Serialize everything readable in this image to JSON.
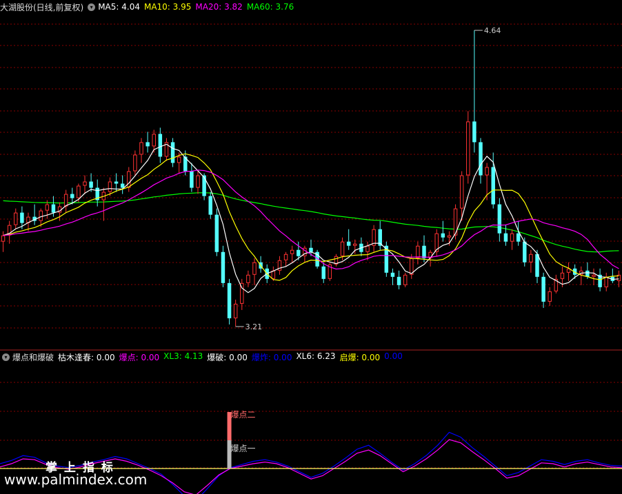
{
  "main_header": {
    "title": "大湖股份(日线,前复权)",
    "items": [
      {
        "label": "MA5: 4.04",
        "color": "#ffffff"
      },
      {
        "label": "MA10: 3.95",
        "color": "#ffff00"
      },
      {
        "label": "MA20: 3.82",
        "color": "#ff00ff"
      },
      {
        "label": "MA60: 3.76",
        "color": "#00ff00"
      }
    ]
  },
  "sub_header": {
    "title": "爆点和爆破",
    "items": [
      {
        "label": "枯木逢春: 0.00",
        "color": "#ffffff"
      },
      {
        "label": "爆点: 0.00",
        "color": "#ff00ff"
      },
      {
        "label": "XL3: 4.13",
        "color": "#00ff00"
      },
      {
        "label": "爆破: 0.00",
        "color": "#ffffff"
      },
      {
        "label": "爆炸: 0.00",
        "color": "#0000ff"
      },
      {
        "label": "XL6: 6.23",
        "color": "#ffffff"
      },
      {
        "label": "启爆: 0.00",
        "color": "#ffff00"
      },
      {
        "label": "0.00",
        "color": "#0000ff"
      }
    ]
  },
  "annotations": {
    "high": "4.64",
    "low": "3.21"
  },
  "signal_labels": {
    "upper": "爆点二",
    "lower": "爆点一"
  },
  "watermark": {
    "title": "掌 上 指 标",
    "url": "www.palmindex.com"
  },
  "colors": {
    "up": "#ff3232",
    "down": "#54ffff",
    "ma5": "#ffffff",
    "ma10": "#ffff00",
    "ma20": "#ff00ff",
    "ma60": "#00ff00",
    "grid": "#8b0000"
  },
  "chart_data": {
    "type": "candlestick",
    "y_range": [
      3.15,
      4.72
    ],
    "ma_windows": [
      5,
      10,
      20,
      60
    ],
    "ma60_start": 3.82,
    "candles": [
      [
        3.62,
        3.67,
        3.57,
        3.65
      ],
      [
        3.65,
        3.72,
        3.61,
        3.7
      ],
      [
        3.7,
        3.78,
        3.68,
        3.76
      ],
      [
        3.76,
        3.79,
        3.68,
        3.71
      ],
      [
        3.71,
        3.76,
        3.67,
        3.74
      ],
      [
        3.74,
        3.8,
        3.7,
        3.72
      ],
      [
        3.72,
        3.78,
        3.69,
        3.77
      ],
      [
        3.77,
        3.82,
        3.73,
        3.8
      ],
      [
        3.8,
        3.84,
        3.74,
        3.76
      ],
      [
        3.76,
        3.81,
        3.72,
        3.79
      ],
      [
        3.79,
        3.87,
        3.76,
        3.85
      ],
      [
        3.85,
        3.88,
        3.8,
        3.83
      ],
      [
        3.83,
        3.9,
        3.81,
        3.89
      ],
      [
        3.89,
        3.94,
        3.85,
        3.91
      ],
      [
        3.91,
        3.95,
        3.86,
        3.88
      ],
      [
        3.88,
        3.92,
        3.79,
        3.82
      ],
      [
        3.82,
        3.88,
        3.72,
        3.86
      ],
      [
        3.86,
        3.93,
        3.84,
        3.91
      ],
      [
        3.91,
        3.95,
        3.86,
        3.9
      ],
      [
        3.9,
        3.94,
        3.85,
        3.88
      ],
      [
        3.88,
        3.98,
        3.86,
        3.96
      ],
      [
        3.96,
        4.06,
        3.94,
        4.04
      ],
      [
        4.04,
        4.12,
        4.0,
        4.1
      ],
      [
        4.1,
        4.15,
        4.05,
        4.08
      ],
      [
        4.08,
        4.16,
        4.05,
        4.14
      ],
      [
        4.14,
        4.17,
        4.0,
        4.03
      ],
      [
        4.03,
        4.12,
        4.01,
        4.1
      ],
      [
        4.1,
        4.12,
        3.98,
        4.0
      ],
      [
        4.0,
        4.05,
        3.95,
        4.03
      ],
      [
        4.03,
        4.06,
        3.94,
        3.96
      ],
      [
        3.96,
        4.0,
        3.86,
        3.88
      ],
      [
        3.88,
        3.96,
        3.85,
        3.94
      ],
      [
        3.94,
        3.95,
        3.82,
        3.84
      ],
      [
        3.84,
        3.86,
        3.73,
        3.75
      ],
      [
        3.75,
        3.78,
        3.55,
        3.57
      ],
      [
        3.57,
        3.6,
        3.4,
        3.42
      ],
      [
        3.42,
        3.44,
        3.22,
        3.25
      ],
      [
        3.25,
        3.34,
        3.21,
        3.32
      ],
      [
        3.32,
        3.44,
        3.29,
        3.42
      ],
      [
        3.42,
        3.48,
        3.4,
        3.46
      ],
      [
        3.46,
        3.54,
        3.41,
        3.52
      ],
      [
        3.52,
        3.55,
        3.47,
        3.49
      ],
      [
        3.49,
        3.51,
        3.42,
        3.44
      ],
      [
        3.44,
        3.5,
        3.43,
        3.48
      ],
      [
        3.48,
        3.55,
        3.46,
        3.53
      ],
      [
        3.53,
        3.57,
        3.5,
        3.56
      ],
      [
        3.56,
        3.6,
        3.52,
        3.58
      ],
      [
        3.58,
        3.62,
        3.53,
        3.55
      ],
      [
        3.55,
        3.6,
        3.52,
        3.59
      ],
      [
        3.59,
        3.63,
        3.55,
        3.57
      ],
      [
        3.57,
        3.58,
        3.49,
        3.5
      ],
      [
        3.5,
        3.52,
        3.42,
        3.44
      ],
      [
        3.44,
        3.52,
        3.43,
        3.51
      ],
      [
        3.51,
        3.56,
        3.5,
        3.55
      ],
      [
        3.55,
        3.64,
        3.53,
        3.62
      ],
      [
        3.62,
        3.68,
        3.58,
        3.6
      ],
      [
        3.6,
        3.63,
        3.56,
        3.61
      ],
      [
        3.61,
        3.64,
        3.55,
        3.57
      ],
      [
        3.57,
        3.62,
        3.53,
        3.6
      ],
      [
        3.6,
        3.7,
        3.57,
        3.68
      ],
      [
        3.68,
        3.72,
        3.58,
        3.6
      ],
      [
        3.6,
        3.62,
        3.45,
        3.47
      ],
      [
        3.47,
        3.49,
        3.41,
        3.45
      ],
      [
        3.45,
        3.48,
        3.39,
        3.41
      ],
      [
        3.41,
        3.47,
        3.4,
        3.46
      ],
      [
        3.46,
        3.56,
        3.44,
        3.54
      ],
      [
        3.54,
        3.62,
        3.51,
        3.6
      ],
      [
        3.6,
        3.65,
        3.52,
        3.54
      ],
      [
        3.54,
        3.58,
        3.5,
        3.57
      ],
      [
        3.57,
        3.68,
        3.55,
        3.66
      ],
      [
        3.66,
        3.72,
        3.62,
        3.64
      ],
      [
        3.64,
        3.67,
        3.6,
        3.65
      ],
      [
        3.65,
        3.8,
        3.63,
        3.78
      ],
      [
        3.78,
        3.96,
        3.72,
        3.94
      ],
      [
        3.94,
        4.25,
        3.9,
        4.2
      ],
      [
        4.2,
        4.64,
        4.05,
        4.1
      ],
      [
        4.1,
        4.12,
        3.9,
        3.94
      ],
      [
        3.94,
        4.0,
        3.82,
        3.98
      ],
      [
        3.98,
        4.05,
        3.78,
        3.8
      ],
      [
        3.8,
        3.83,
        3.62,
        3.66
      ],
      [
        3.66,
        3.7,
        3.6,
        3.62
      ],
      [
        3.62,
        3.68,
        3.58,
        3.66
      ],
      [
        3.66,
        3.72,
        3.6,
        3.62
      ],
      [
        3.62,
        3.64,
        3.5,
        3.52
      ],
      [
        3.52,
        3.58,
        3.47,
        3.56
      ],
      [
        3.56,
        3.58,
        3.42,
        3.45
      ],
      [
        3.45,
        3.47,
        3.3,
        3.33
      ],
      [
        3.33,
        3.4,
        3.31,
        3.38
      ],
      [
        3.38,
        3.46,
        3.37,
        3.44
      ],
      [
        3.44,
        3.5,
        3.4,
        3.47
      ],
      [
        3.47,
        3.52,
        3.43,
        3.49
      ],
      [
        3.49,
        3.51,
        3.44,
        3.46
      ],
      [
        3.46,
        3.5,
        3.41,
        3.48
      ],
      [
        3.48,
        3.52,
        3.44,
        3.45
      ],
      [
        3.45,
        3.49,
        3.41,
        3.46
      ],
      [
        3.46,
        3.49,
        3.38,
        3.4
      ],
      [
        3.4,
        3.47,
        3.38,
        3.45
      ],
      [
        3.45,
        3.49,
        3.42,
        3.43
      ],
      [
        3.43,
        3.48,
        3.4,
        3.46
      ]
    ],
    "sub_lines": {
      "series": [
        {
          "color": "#0000ff",
          "values": [
            0.6,
            1.0,
            1.6,
            1.4,
            0.7,
            0.3,
            0.1,
            0.4,
            0.8,
            1.1,
            1.5,
            1.2,
            0.6,
            0.0,
            -0.7,
            -2.0,
            -3.4,
            -4.0,
            -2.5,
            -0.9,
            0.1,
            0.5,
            0.9,
            1.1,
            0.8,
            0.3,
            -0.4,
            -1.1,
            -0.6,
            0.3,
            1.3,
            2.4,
            2.9,
            1.9,
            0.8,
            -0.2,
            0.6,
            1.6,
            2.9,
            4.5,
            3.9,
            2.6,
            1.5,
            0.3,
            -0.9,
            -0.5,
            0.3,
            1.1,
            0.9,
            0.5,
            0.9,
            1.1,
            0.7,
            0.4,
            0.3
          ]
        },
        {
          "color": "#ff00ff",
          "values": [
            0.2,
            0.6,
            1.2,
            1.1,
            0.5,
            0.1,
            -0.1,
            0.2,
            0.6,
            0.9,
            1.2,
            0.9,
            0.4,
            -0.2,
            -0.9,
            -1.8,
            -2.9,
            -3.3,
            -2.1,
            -0.8,
            0.0,
            0.3,
            0.6,
            0.8,
            0.6,
            0.1,
            -0.6,
            -1.3,
            -0.9,
            0.0,
            0.9,
            1.9,
            2.3,
            1.6,
            0.6,
            -0.4,
            0.3,
            1.2,
            2.3,
            3.6,
            3.2,
            2.1,
            1.1,
            0.0,
            -1.2,
            -0.9,
            -0.1,
            0.7,
            0.6,
            0.2,
            0.6,
            0.8,
            0.5,
            0.2,
            0.1
          ]
        }
      ],
      "y_range": [
        -5,
        7
      ]
    },
    "signal_bar": {
      "index": 36,
      "upper_value": 1.0,
      "lower_value": 0.5
    }
  }
}
